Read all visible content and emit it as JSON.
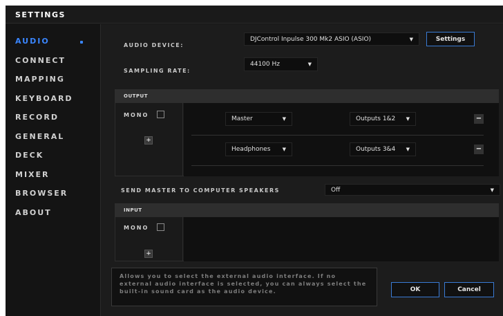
{
  "window": {
    "title": "SETTINGS"
  },
  "sidebar": {
    "items": [
      {
        "label": "AUDIO",
        "active": true
      },
      {
        "label": "CONNECT"
      },
      {
        "label": "MAPPING"
      },
      {
        "label": "KEYBOARD"
      },
      {
        "label": "RECORD"
      },
      {
        "label": "GENERAL"
      },
      {
        "label": "DECK"
      },
      {
        "label": "MIXER"
      },
      {
        "label": "BROWSER"
      },
      {
        "label": "ABOUT"
      }
    ]
  },
  "audio": {
    "device_label": "AUDIO DEVICE:",
    "device_value": "DJControl Inpulse 300 Mk2 ASIO (ASIO)",
    "settings_button": "Settings",
    "sampling_label": "SAMPLING RATE:",
    "sampling_value": "44100 Hz"
  },
  "output": {
    "title": "OUTPUT",
    "mono_label": "MONO",
    "add_symbol": "+",
    "rows": [
      {
        "channel": "Master",
        "outputs": "Outputs 1&2"
      },
      {
        "channel": "Headphones",
        "outputs": "Outputs 3&4"
      }
    ],
    "remove_symbol": "−"
  },
  "send_master": {
    "label": "SEND MASTER TO COMPUTER SPEAKERS",
    "value": "Off"
  },
  "input": {
    "title": "INPUT",
    "mono_label": "MONO",
    "add_symbol": "+"
  },
  "footer": {
    "description": "Allows you to select the external audio interface. If no external audio interface is selected, you can always select the built-in sound card as the audio device.",
    "ok_button": "OK",
    "cancel_button": "Cancel"
  },
  "icons": {
    "dropdown": "dropdown-arrow-icon",
    "arrow_glyph": "▼"
  },
  "colors": {
    "accent": "#3a86ff",
    "button_border": "#3a7bd5",
    "background": "#1c1c1c"
  }
}
